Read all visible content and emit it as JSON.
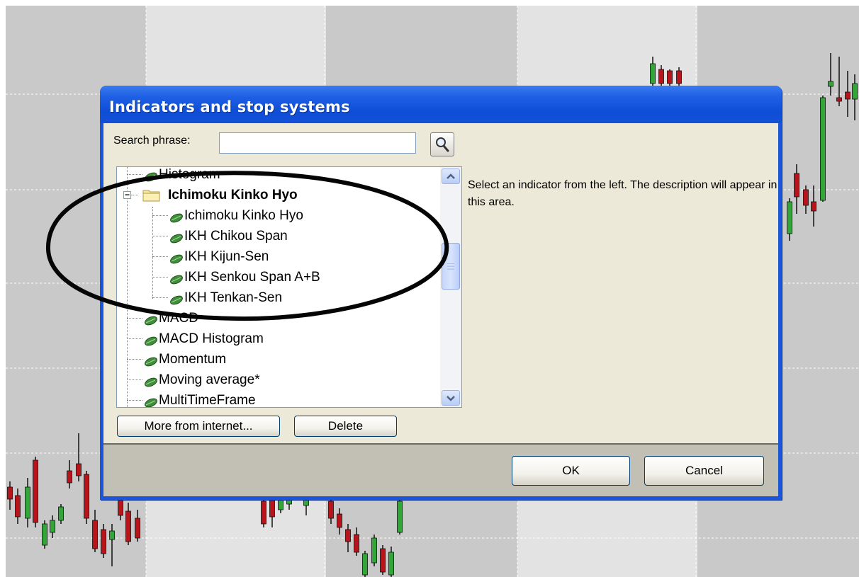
{
  "dialog": {
    "title": "Indicators and stop systems",
    "search_label": "Search phrase:",
    "search_value": "",
    "description": "Select an indicator from the left. The description will appear in this area.",
    "buttons": {
      "more": "More from internet...",
      "delete": "Delete",
      "ok": "OK",
      "cancel": "Cancel"
    }
  },
  "tree": {
    "items": [
      {
        "label": "Histogram",
        "level": 0,
        "type": "leaf"
      },
      {
        "label": "Ichimoku Kinko Hyo",
        "level": 0,
        "type": "group",
        "expanded": true
      },
      {
        "label": "Ichimoku Kinko Hyo",
        "level": 1,
        "type": "leaf"
      },
      {
        "label": "IKH Chikou Span",
        "level": 1,
        "type": "leaf"
      },
      {
        "label": "IKH Kijun-Sen",
        "level": 1,
        "type": "leaf"
      },
      {
        "label": "IKH Senkou Span A+B",
        "level": 1,
        "type": "leaf"
      },
      {
        "label": "IKH Tenkan-Sen",
        "level": 1,
        "type": "leaf"
      },
      {
        "label": "MACD",
        "level": 0,
        "type": "leaf"
      },
      {
        "label": "MACD Histogram",
        "level": 0,
        "type": "leaf"
      },
      {
        "label": "Momentum",
        "level": 0,
        "type": "leaf"
      },
      {
        "label": "Moving average*",
        "level": 0,
        "type": "leaf"
      },
      {
        "label": "MultiTimeFrame",
        "level": 0,
        "type": "leaf"
      }
    ]
  },
  "colors": {
    "bull": "#33a63a",
    "bear": "#b8141c",
    "title_bar": "#1e5fe4",
    "client": "#ece9d8"
  },
  "icons": {
    "search": "magnifier-icon",
    "leaf": "indicator-leaf-icon",
    "folder": "folder-icon"
  }
}
